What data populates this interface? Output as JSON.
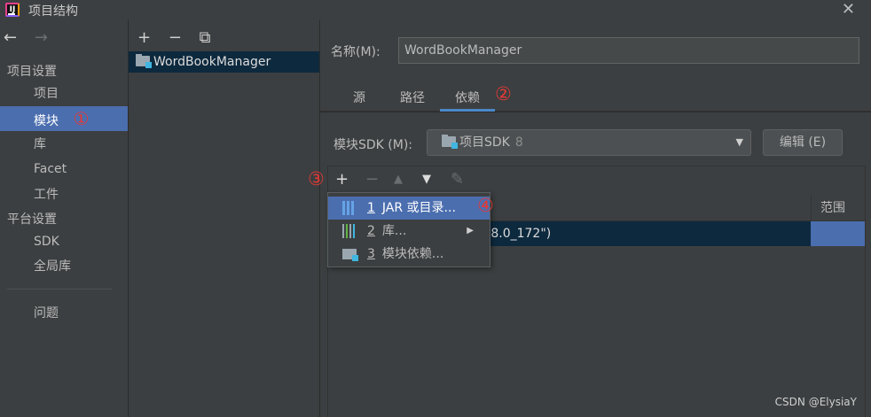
{
  "window": {
    "title": "项目结构",
    "close": "✕"
  },
  "nav": {
    "back": "←",
    "forward": "→",
    "project_settings_header": "项目设置",
    "project_settings_items": [
      "项目",
      "模块",
      "库",
      "Facet",
      "工件"
    ],
    "platform_settings_header": "平台设置",
    "platform_settings_items": [
      "SDK",
      "全局库"
    ],
    "problems": "问题",
    "selected": "模块"
  },
  "modules": {
    "toolbar": {
      "add": "+",
      "remove": "−",
      "copy": "⧉"
    },
    "items": [
      "WordBookManager"
    ]
  },
  "details": {
    "name_label": "名称(M):",
    "name_value": "WordBookManager",
    "tabs": [
      "源",
      "路径",
      "依赖"
    ],
    "active_tab": "依赖",
    "sdk_label": "模块SDK (M):",
    "sdk_value": "项目SDK",
    "sdk_version": "8",
    "edit_button": "编辑 (E)",
    "dep_toolbar": {
      "add": "+",
      "remove": "−",
      "up": "▲",
      "down": "▼",
      "edit": "✎"
    },
    "scope_header": "范围",
    "row_text": "1.8.0_172\")"
  },
  "popup_menu": [
    {
      "num": "1",
      "label": "JAR 或目录...",
      "selected": true
    },
    {
      "num": "2",
      "label": "库...",
      "submenu": true
    },
    {
      "num": "3",
      "label": "模块依赖..."
    }
  ],
  "annotations": [
    "①",
    "②",
    "③",
    "④"
  ],
  "watermark": "CSDN @ElysiaY",
  "colors": {
    "selection": "#4b6eaf",
    "annotation": "#e53935",
    "background": "#3c3f41"
  }
}
